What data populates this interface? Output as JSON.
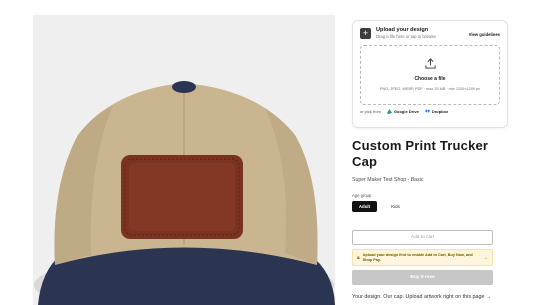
{
  "upload": {
    "icon": "plus-icon",
    "title": "Upload your design",
    "subtitle": "Drag a file here or tap to browse",
    "guidelines_link": "View guidelines",
    "choose_file": "Choose a file",
    "formats": "PNG, JPEG, WEBP, PDF · max 25 MB · min 1200×1200 px",
    "import_label": "or pick from",
    "sources": [
      {
        "name": "Google Drive",
        "icon": "google-drive-icon"
      },
      {
        "name": "Dropbox",
        "icon": "dropbox-icon"
      }
    ]
  },
  "product": {
    "title": "Custom Print Trucker Cap",
    "shop": "Super Maker Test Shop - Basic",
    "age_group_label": "Age group",
    "age_options": [
      {
        "label": "Adult",
        "selected": true
      },
      {
        "label": "Kids",
        "selected": false
      }
    ],
    "image_alt": "Trucker cap with leather patch"
  },
  "actions": {
    "add_to_cart": "Add to cart",
    "notice": "Upload your design first to enable Add to Cart, Buy Now, and Shop Pay.",
    "buy_now": "Buy it now"
  },
  "tagline": "Your design. Our cap. Upload artwork right on this page →",
  "colors": {
    "cap_crown": "#c9b58f",
    "cap_brim": "#2b3451",
    "patch": "#7a3322",
    "accent_dark": "#111111",
    "notice_bg": "#fdf6dc"
  }
}
